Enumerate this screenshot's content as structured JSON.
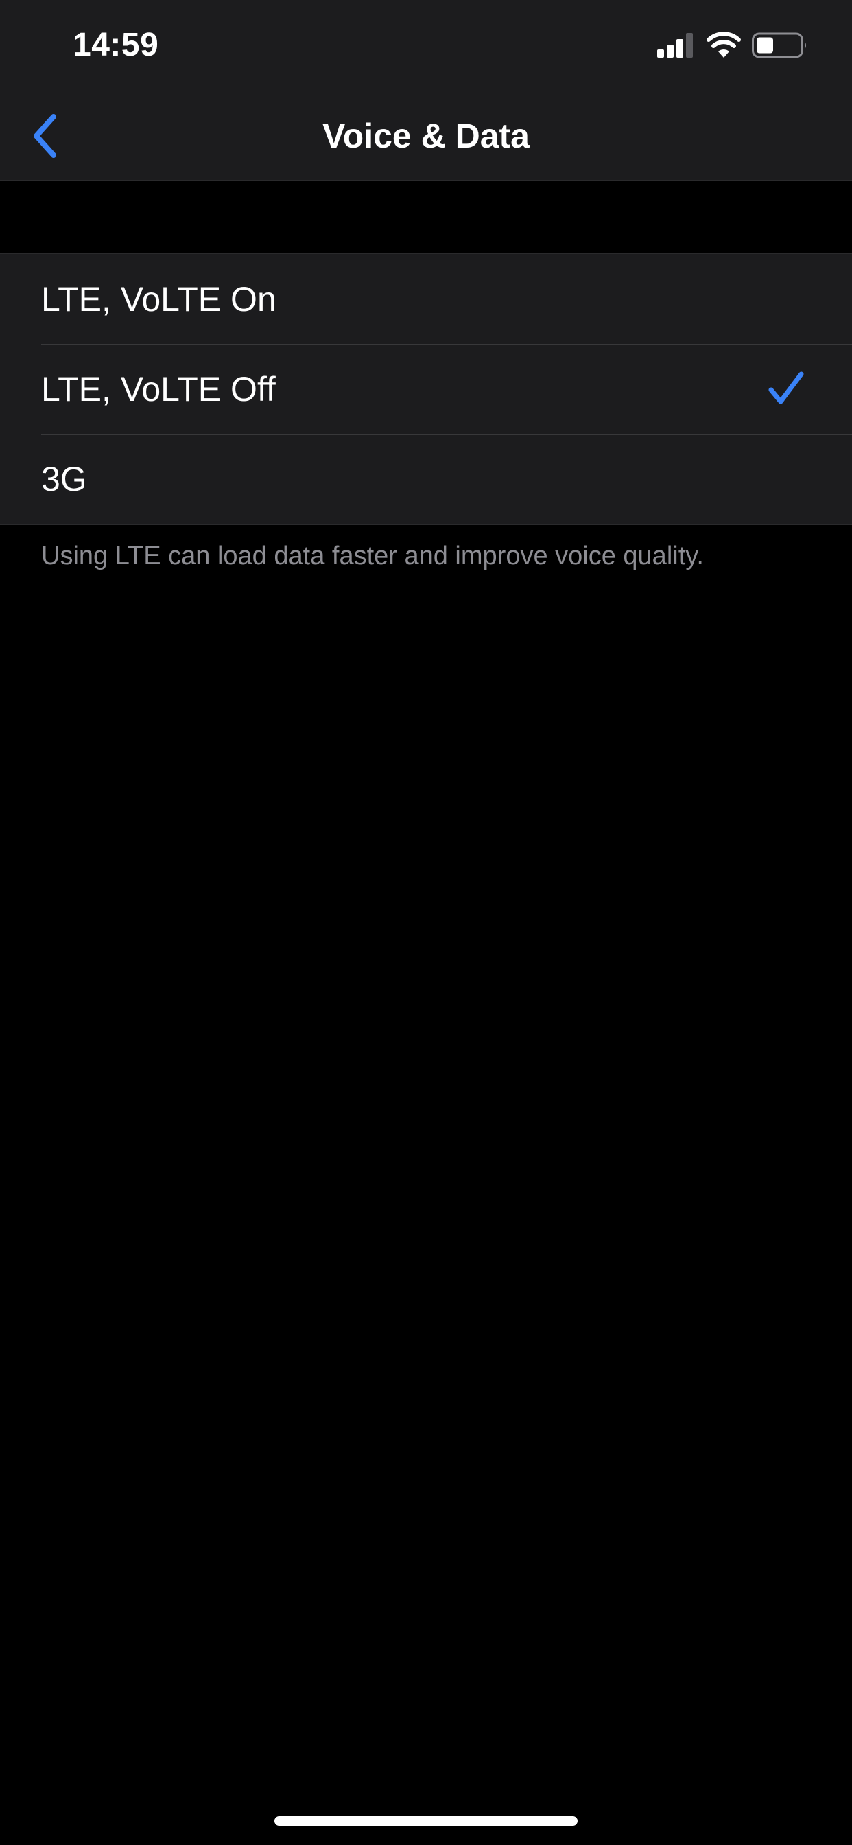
{
  "status_bar": {
    "time": "14:59",
    "icons": [
      "cellular-signal-icon",
      "wifi-icon",
      "battery-icon"
    ]
  },
  "nav": {
    "back_icon": "chevron-left-icon",
    "title": "Voice & Data"
  },
  "options": [
    {
      "label": "LTE, VoLTE On",
      "selected": false
    },
    {
      "label": "LTE, VoLTE Off",
      "selected": true
    },
    {
      "label": "3G",
      "selected": false
    }
  ],
  "footer_note": "Using LTE can load data faster and improve voice quality.",
  "colors": {
    "accent": "#3a82f7",
    "background": "#000000",
    "group_background": "#1c1c1e",
    "secondary_text": "#8d8d93"
  }
}
